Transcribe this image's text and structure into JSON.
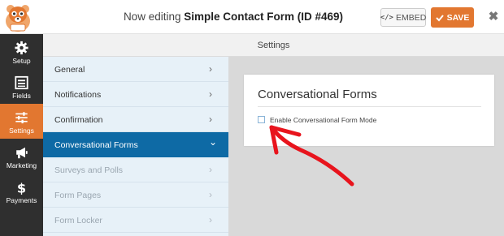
{
  "header": {
    "title_prefix": "Now editing",
    "form_name": "Simple Contact Form (ID #469)",
    "embed_label": "EMBED",
    "embed_code_glyph": "</>",
    "save_label": "SAVE",
    "close_glyph": "✖"
  },
  "nav": {
    "items": [
      {
        "label": "Setup",
        "icon": "gear-icon"
      },
      {
        "label": "Fields",
        "icon": "fields-icon"
      },
      {
        "label": "Settings",
        "icon": "sliders-icon"
      },
      {
        "label": "Marketing",
        "icon": "megaphone-icon"
      },
      {
        "label": "Payments",
        "icon": "dollar-icon"
      }
    ],
    "active": "Settings"
  },
  "settings_header": "Settings",
  "panels": [
    {
      "label": "General",
      "state": "normal",
      "chevron": "›"
    },
    {
      "label": "Notifications",
      "state": "normal",
      "chevron": "›"
    },
    {
      "label": "Confirmation",
      "state": "normal",
      "chevron": "›"
    },
    {
      "label": "Conversational Forms",
      "state": "active",
      "chevron": "⌄"
    },
    {
      "label": "Surveys and Polls",
      "state": "disabled",
      "chevron": "›"
    },
    {
      "label": "Form Pages",
      "state": "disabled",
      "chevron": "›"
    },
    {
      "label": "Form Locker",
      "state": "disabled",
      "chevron": "›"
    }
  ],
  "content": {
    "card_title": "Conversational Forms",
    "checkbox_label": "Enable Conversational Form Mode",
    "checkbox_checked": false
  },
  "colors": {
    "accent_orange": "#e27730",
    "active_blue": "#0e6aa5",
    "panel_bg": "#e7f1f8",
    "nav_dark": "#2f2f2f",
    "annotation_red": "#e8141d"
  }
}
